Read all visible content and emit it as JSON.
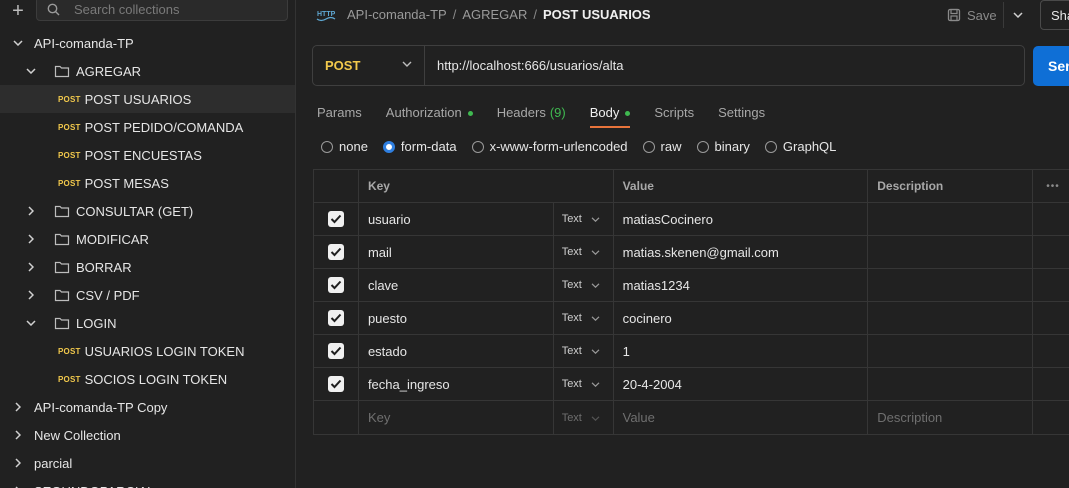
{
  "sidebar": {
    "search_placeholder": "Search collections",
    "tree": [
      {
        "type": "collection",
        "label": "API-comanda-TP",
        "expanded": true,
        "level": 0
      },
      {
        "type": "folder",
        "label": "AGREGAR",
        "expanded": true,
        "level": 1
      },
      {
        "type": "request",
        "method": "POST",
        "label": "POST USUARIOS",
        "level": 2,
        "selected": true
      },
      {
        "type": "request",
        "method": "POST",
        "label": "POST PEDIDO/COMANDA",
        "level": 2
      },
      {
        "type": "request",
        "method": "POST",
        "label": "POST ENCUESTAS",
        "level": 2
      },
      {
        "type": "request",
        "method": "POST",
        "label": "POST MESAS",
        "level": 2
      },
      {
        "type": "folder",
        "label": "CONSULTAR (GET)",
        "expanded": false,
        "level": 1
      },
      {
        "type": "folder",
        "label": "MODIFICAR",
        "expanded": false,
        "level": 1
      },
      {
        "type": "folder",
        "label": "BORRAR",
        "expanded": false,
        "level": 1
      },
      {
        "type": "folder",
        "label": "CSV / PDF",
        "expanded": false,
        "level": 1
      },
      {
        "type": "folder",
        "label": "LOGIN",
        "expanded": true,
        "level": 1
      },
      {
        "type": "request",
        "method": "POST",
        "label": "USUARIOS LOGIN TOKEN",
        "level": 2
      },
      {
        "type": "request",
        "method": "POST",
        "label": "SOCIOS LOGIN TOKEN",
        "level": 2
      },
      {
        "type": "collection",
        "label": "API-comanda-TP Copy",
        "expanded": false,
        "level": 0
      },
      {
        "type": "collection",
        "label": "New Collection",
        "expanded": false,
        "level": 0
      },
      {
        "type": "collection",
        "label": "parcial",
        "expanded": false,
        "level": 0
      },
      {
        "type": "collection",
        "label": "SEGUNDOPARCIAL",
        "expanded": false,
        "level": 0
      }
    ]
  },
  "header": {
    "crumbs": [
      "API-comanda-TP",
      "AGREGAR"
    ],
    "current": "POST USUARIOS",
    "separator": "/",
    "save_label": "Save",
    "share_label": "Share"
  },
  "request": {
    "method": "POST",
    "url": "http://localhost:666/usuarios/alta",
    "send_label": "Send"
  },
  "tabs": [
    {
      "label": "Params"
    },
    {
      "label": "Authorization",
      "dot": true
    },
    {
      "label": "Headers",
      "count": "(9)"
    },
    {
      "label": "Body",
      "dot": true,
      "active": true
    },
    {
      "label": "Scripts"
    },
    {
      "label": "Settings"
    }
  ],
  "body_types": [
    {
      "label": "none",
      "selected": false
    },
    {
      "label": "form-data",
      "selected": true
    },
    {
      "label": "x-www-form-urlencoded",
      "selected": false
    },
    {
      "label": "raw",
      "selected": false
    },
    {
      "label": "binary",
      "selected": false
    },
    {
      "label": "GraphQL",
      "selected": false
    }
  ],
  "table": {
    "headers": {
      "key": "Key",
      "value": "Value",
      "description": "Description",
      "more": "•••"
    },
    "rows": [
      {
        "checked": true,
        "key": "usuario",
        "type": "Text",
        "value": "matiasCocinero",
        "description": ""
      },
      {
        "checked": true,
        "key": "mail",
        "type": "Text",
        "value": "matias.skenen@gmail.com",
        "description": ""
      },
      {
        "checked": true,
        "key": "clave",
        "type": "Text",
        "value": "matias1234",
        "description": ""
      },
      {
        "checked": true,
        "key": "puesto",
        "type": "Text",
        "value": "cocinero",
        "description": ""
      },
      {
        "checked": true,
        "key": "estado",
        "type": "Text",
        "value": "1",
        "description": ""
      },
      {
        "checked": true,
        "key": "fecha_ingreso",
        "type": "Text",
        "value": "20-4-2004",
        "description": ""
      }
    ],
    "placeholder": {
      "key": "Key",
      "type": "Text",
      "value": "Value",
      "description": "Description"
    }
  },
  "colors": {
    "post_method": "#f2c94c",
    "send_button": "#0f6fd6",
    "active_tab_underline": "#e8743b",
    "status_dot": "#3fb950"
  }
}
